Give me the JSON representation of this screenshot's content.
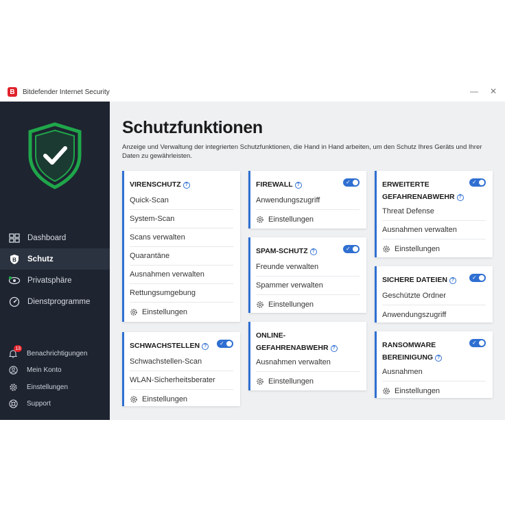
{
  "window": {
    "title": "Bitdefender Internet Security",
    "logo_letter": "B",
    "minimize_glyph": "—",
    "close_glyph": "✕"
  },
  "colors": {
    "accent": "#2f6fd1",
    "sidebar_bg": "#1e2430",
    "shield_green": "#1fa64a",
    "brand_red": "#e0222b"
  },
  "sidebar": {
    "items": [
      {
        "label": "Dashboard",
        "icon": "dashboard-icon"
      },
      {
        "label": "Schutz",
        "icon": "shield-b-icon",
        "active": true
      },
      {
        "label": "Privatsphäre",
        "icon": "privacy-eye-icon"
      },
      {
        "label": "Dienstprogramme",
        "icon": "gauge-icon"
      }
    ],
    "bottom_items": [
      {
        "label": "Benachrichtigungen",
        "icon": "bell-icon",
        "badge": "13"
      },
      {
        "label": "Mein Konto",
        "icon": "account-icon"
      },
      {
        "label": "Einstellungen",
        "icon": "gear-icon"
      },
      {
        "label": "Support",
        "icon": "support-icon"
      }
    ]
  },
  "main": {
    "title": "Schutzfunktionen",
    "description": "Anzeige und Verwaltung der integrierten Schutzfunktionen, die Hand in Hand arbeiten, um den Schutz Ihres Geräts und Ihrer Daten zu gewährleisten.",
    "settings_label": "Einstellungen",
    "cards": {
      "virenschutz": {
        "title": "VIRENSCHUTZ",
        "rows": [
          "Quick-Scan",
          "System-Scan",
          "Scans verwalten",
          "Quarantäne",
          "Ausnahmen verwalten",
          "Rettungsumgebung"
        ],
        "toggle": false
      },
      "schwachstellen": {
        "title": "SCHWACHSTELLEN",
        "rows": [
          "Schwachstellen-Scan",
          "WLAN-Sicherheitsberater"
        ],
        "toggle": true
      },
      "firewall": {
        "title": "FIREWALL",
        "rows": [
          "Anwendungszugriff"
        ],
        "toggle": true
      },
      "spamschutz": {
        "title": "SPAM-SCHUTZ",
        "rows": [
          "Freunde verwalten",
          "Spammer verwalten"
        ],
        "toggle": true
      },
      "online": {
        "title_line1": "ONLINE-",
        "title_line2": "GEFAHRENABWEHR",
        "rows": [
          "Ausnahmen verwalten"
        ],
        "toggle": false
      },
      "erweiterte": {
        "title_line1": "ERWEITERTE",
        "title_line2": "GEFAHRENABWEHR",
        "rows": [
          "Threat Defense",
          "Ausnahmen verwalten"
        ],
        "toggle": true
      },
      "sichere": {
        "title": "SICHERE DATEIEN",
        "rows": [
          "Geschützte Ordner",
          "Anwendungszugriff"
        ],
        "toggle": true
      },
      "ransomware": {
        "title_line1": "RANSOMWARE",
        "title_line2": "BEREINIGUNG",
        "rows": [
          "Ausnahmen"
        ],
        "toggle": true
      }
    }
  }
}
